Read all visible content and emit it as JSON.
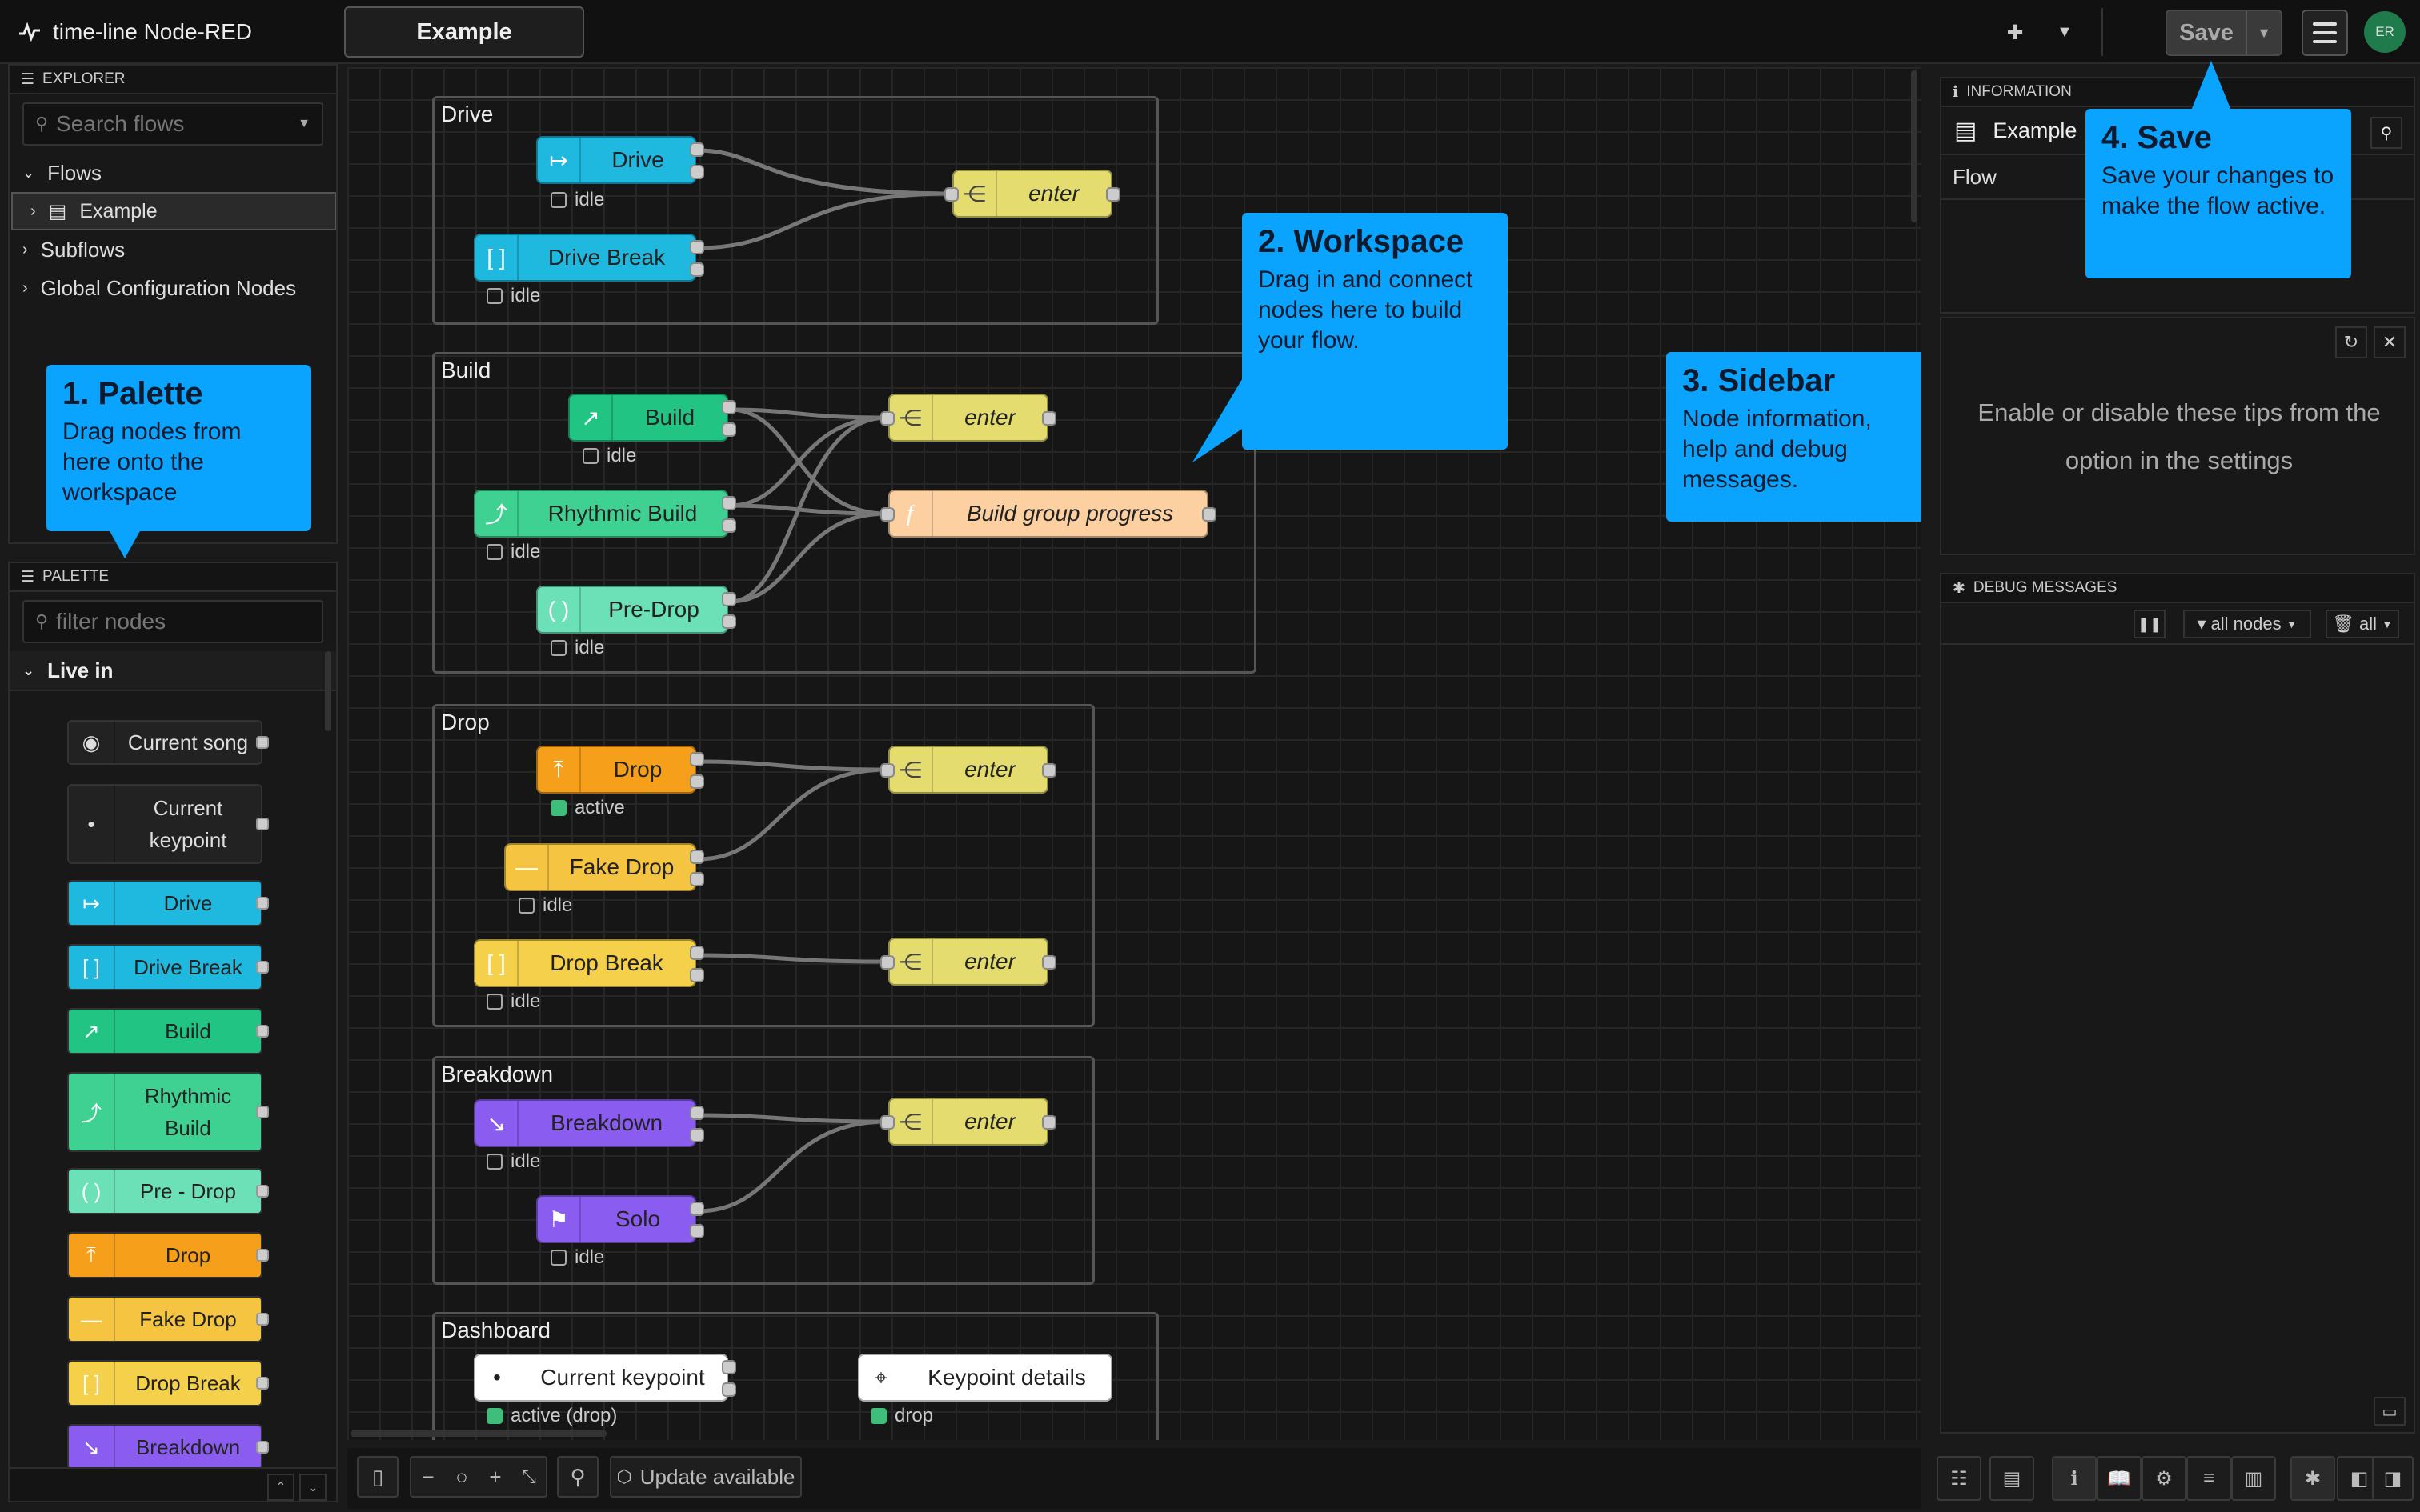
{
  "app": {
    "title": "time-line Node-RED",
    "flow_tab": "Example",
    "deploy_label": "Save",
    "user_initials": "ER"
  },
  "explorer": {
    "header": "EXPLORER",
    "search_placeholder": "Search flows",
    "flows_label": "Flows",
    "flows": [
      "Example"
    ],
    "subflows_label": "Subflows",
    "global_config_label": "Global Configuration Nodes"
  },
  "palette": {
    "header": "PALETTE",
    "filter_placeholder": "filter nodes",
    "category": "Live in",
    "nodes": [
      "Current song",
      "Current keypoint",
      "Drive",
      "Drive Break",
      "Build",
      "Rhythmic Build",
      "Pre - Drop",
      "Drop",
      "Fake Drop",
      "Drop Break",
      "Breakdown"
    ]
  },
  "workspace": {
    "groups": [
      "Drive",
      "Build",
      "Drop",
      "Breakdown",
      "Dashboard"
    ],
    "nodes": {
      "drive": "Drive",
      "drive_break": "Drive Break",
      "enter": "enter",
      "build": "Build",
      "rhythmic_build": "Rhythmic Build",
      "pre_drop": "Pre-Drop",
      "build_progress": "Build group progress",
      "drop": "Drop",
      "fake_drop": "Fake Drop",
      "drop_break": "Drop Break",
      "breakdown": "Breakdown",
      "solo": "Solo",
      "current_keypoint": "Current keypoint",
      "keypoint_details": "Keypoint details"
    },
    "status": {
      "idle": "idle",
      "active": "active",
      "active_drop": "active (drop)",
      "drop": "drop"
    },
    "footer": {
      "update_label": "Update available"
    }
  },
  "tips": {
    "palette": {
      "title": "1. Palette",
      "body": "Drag nodes from here onto the workspace"
    },
    "workspace": {
      "title": "2. Workspace",
      "body": "Drag in and connect nodes here to build your flow."
    },
    "sidebar": {
      "title": "3. Sidebar",
      "body": "Node information, help and debug messages."
    },
    "save": {
      "title": "4. Save",
      "body": "Save your changes to make the flow active."
    }
  },
  "sidebar": {
    "info_header": "INFORMATION",
    "info_flow_name": "Example",
    "info_flow_label": "Flow",
    "tips_text": "Enable or disable these tips from the option in the settings",
    "debug_header": "DEBUG MESSAGES",
    "debug_filter": "all nodes",
    "debug_scope": "all"
  },
  "colors": {
    "drive": "#1fb8df",
    "build": "#22c484",
    "rhythmic": "#3fd191",
    "predrop": "#6ce0b6",
    "drop": "#f59f1b",
    "fakedrop": "#f5c542",
    "dropbreak": "#f5d04a",
    "breakdown": "#8a5cf0",
    "enter": "#e4dc6e",
    "function": "#fdd0a2",
    "tip": "#0aa4ff"
  }
}
